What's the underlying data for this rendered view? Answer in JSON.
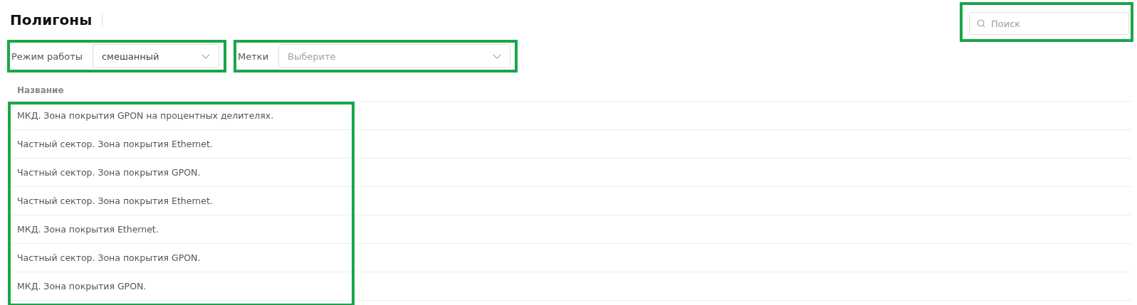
{
  "page": {
    "title": "Полигоны"
  },
  "search": {
    "placeholder": "Поиск"
  },
  "filters": [
    {
      "label": "Режим работы",
      "value": "смешанный"
    },
    {
      "label": "Метки",
      "placeholder": "Выберите"
    }
  ],
  "table": {
    "columns": [
      "Название"
    ],
    "rows": [
      [
        "МКД. Зона покрытия GPON на процентных делителях."
      ],
      [
        "Частный сектор. Зона покрытия Ethernet."
      ],
      [
        "Частный сектор. Зона покрытия GPON."
      ],
      [
        "Частный сектор. Зона покрытия Ethernet."
      ],
      [
        "МКД. Зона покрытия Ethernet."
      ],
      [
        "Частный сектор. Зона покрытия GPON."
      ],
      [
        "МКД. Зона покрытия GPON."
      ]
    ]
  }
}
